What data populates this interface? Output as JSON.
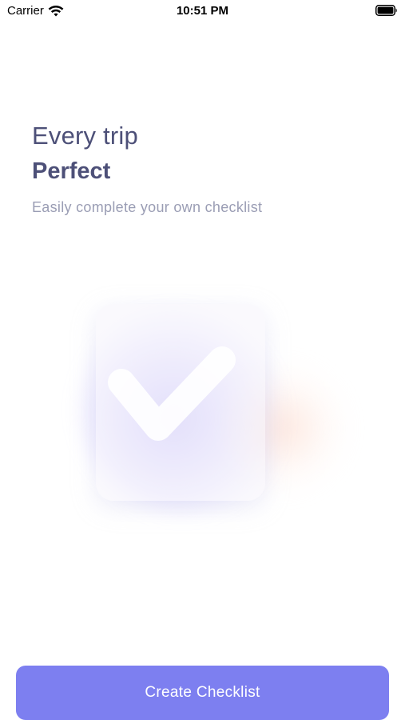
{
  "status_bar": {
    "carrier": "Carrier",
    "time": "10:51 PM",
    "wifi_icon": "wifi-icon",
    "battery_icon": "battery-icon"
  },
  "onboarding": {
    "title_line1": "Every trip",
    "title_line2": "Perfect",
    "subtitle": "Easily complete your own checklist",
    "illustration_icon": "checkmark-icon"
  },
  "actions": {
    "create_button_label": "Create Checklist"
  },
  "colors": {
    "accent": "#7d7ff0",
    "heading": "#4d5078",
    "subtitle": "#9a9db4"
  }
}
